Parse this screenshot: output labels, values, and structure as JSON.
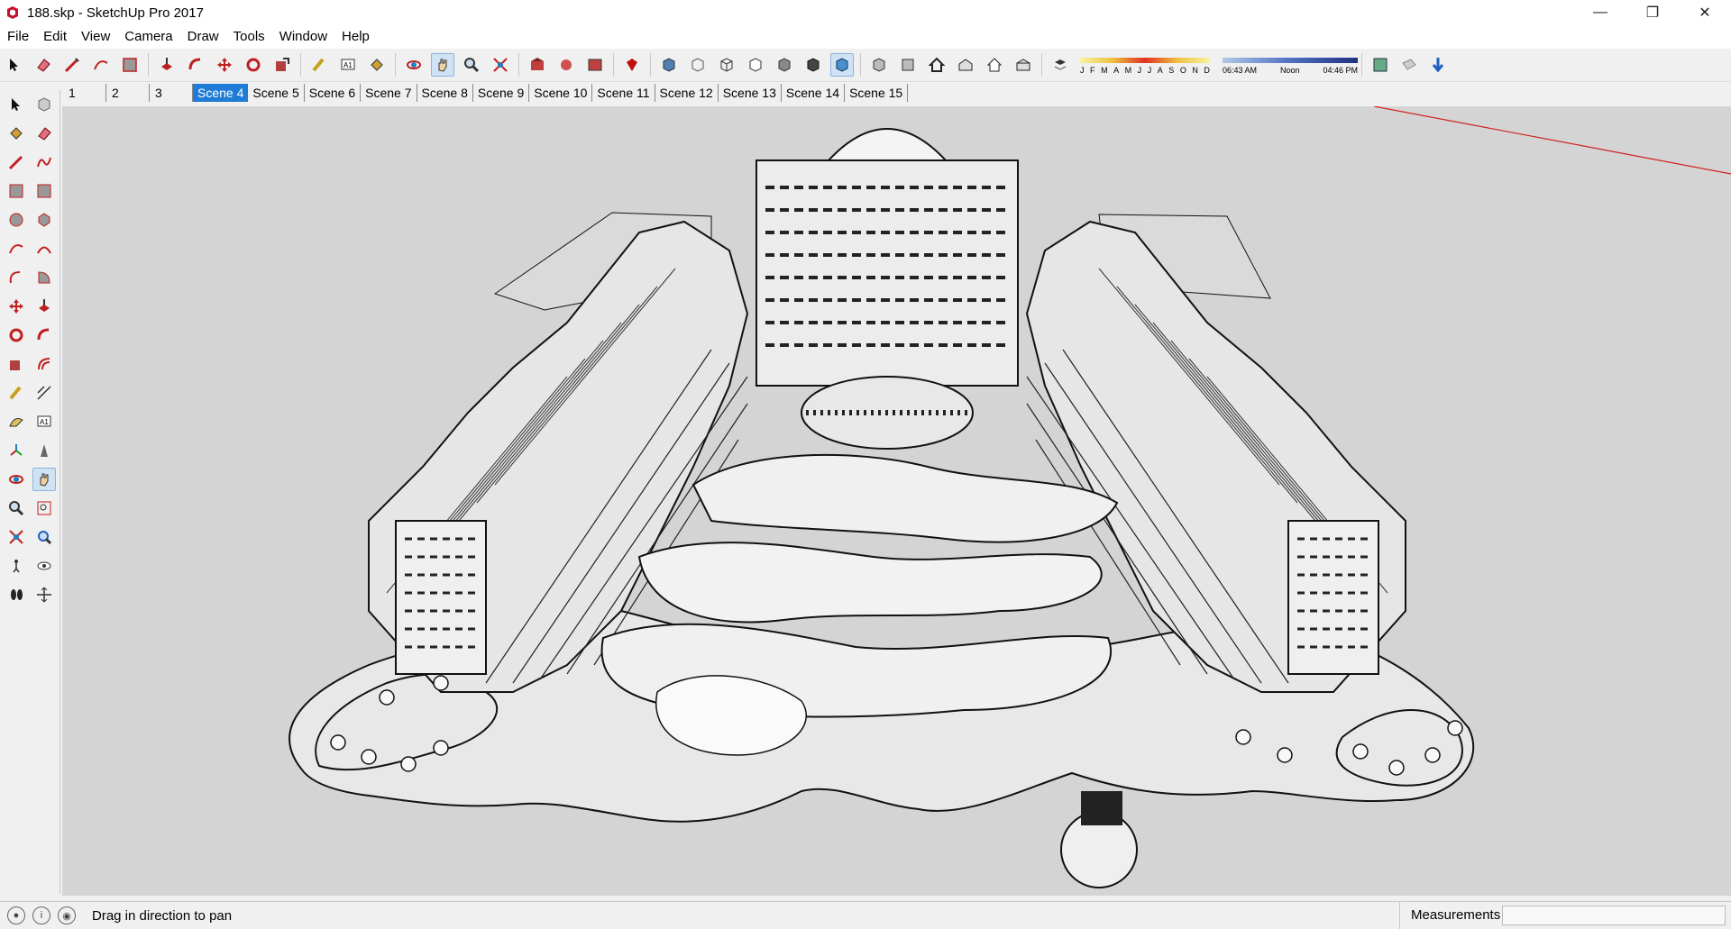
{
  "window": {
    "title": "188.skp - SketchUp Pro 2017",
    "minimize": "—",
    "restore": "❐",
    "close": "✕"
  },
  "menu": {
    "items": [
      "File",
      "Edit",
      "View",
      "Camera",
      "Draw",
      "Tools",
      "Window",
      "Help"
    ]
  },
  "shadows": {
    "months": [
      "J",
      "F",
      "M",
      "A",
      "M",
      "J",
      "J",
      "A",
      "S",
      "O",
      "N",
      "D"
    ],
    "time_start": "06:43 AM",
    "time_mid": "Noon",
    "time_end": "04:46 PM"
  },
  "scenes": {
    "tabs": [
      "1",
      "2",
      "3",
      "Scene 4",
      "Scene 5",
      "Scene 6",
      "Scene 7",
      "Scene 8",
      "Scene 9",
      "Scene 10",
      "Scene 11",
      "Scene 12",
      "Scene 13",
      "Scene 14",
      "Scene 15"
    ],
    "active": "Scene 4"
  },
  "status": {
    "hint": "Drag in direction to pan",
    "measurements_label": "Measurements",
    "measurements_value": ""
  },
  "colors": {
    "accent": "#1e7bd6",
    "viewport_bg": "#d4d4d4",
    "axis_red": "#d02020"
  }
}
